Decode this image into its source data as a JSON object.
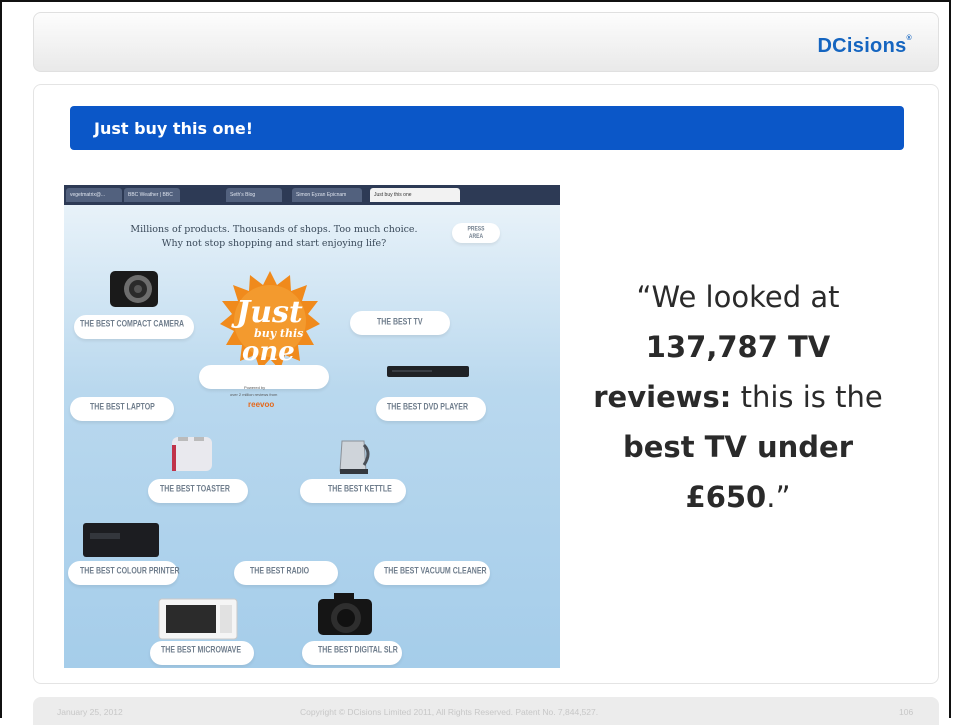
{
  "header": {
    "logo_text": "DCisions",
    "logo_mark": "®"
  },
  "slide": {
    "title": "Just buy this one!"
  },
  "screenshot": {
    "tabs": [
      "vegetmatrix@...",
      "BBC Weather | BBC",
      "Seth's Blog",
      "Simon Eyzan Epicnam",
      "Just buy this one"
    ],
    "tagline_1": "Millions of products. Thousands of shops. Too much choice.",
    "tagline_2": "Why not stop shopping and start enjoying life?",
    "press_button": "PRESS AREA",
    "burst": {
      "line1": "Just",
      "line2": "buy this",
      "line3": "one"
    },
    "powered_by": "Powered by",
    "powered_sub": "over 2 million reviews from",
    "powered_brand": "reevoo",
    "products": [
      {
        "label": "THE BEST COMPACT CAMERA"
      },
      {
        "label": "THE BEST TV"
      },
      {
        "label": "THE BEST LAPTOP"
      },
      {
        "label": "THE BEST DVD PLAYER"
      },
      {
        "label": "THE BEST TOASTER"
      },
      {
        "label": "THE BEST KETTLE"
      },
      {
        "label": "THE BEST COLOUR PRINTER"
      },
      {
        "label": "THE BEST RADIO"
      },
      {
        "label": "THE BEST VACUUM CLEANER"
      },
      {
        "label": "THE BEST MICROWAVE"
      },
      {
        "label": "THE BEST DIGITAL SLR"
      }
    ]
  },
  "quote": {
    "open": "“We looked at ",
    "bold1": "137,787 TV reviews:",
    "mid": " this is the ",
    "bold2": "best TV under £650",
    "close": ".”"
  },
  "footer": {
    "date": "January 25, 2012",
    "copyright": "Copyright © DCisions Limited 2011, All Rights Reserved. Patent No. 7,844,527.",
    "page": "106"
  },
  "colors": {
    "brand_blue": "#1565c0",
    "title_bar": "#0b57c8",
    "burst_orange": "#f08a1c"
  }
}
